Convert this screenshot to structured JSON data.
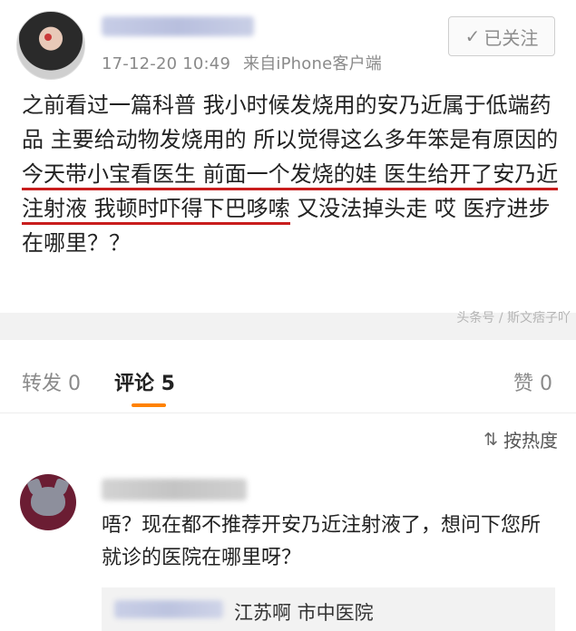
{
  "post": {
    "timestamp": "17-12-20 10:49",
    "source": "来自iPhone客户端",
    "follow_check": "✓",
    "follow_label": "已关注",
    "text_before": "之前看过一篇科普 我小时候发烧用的安乃近属于低端药品 主要给动物发烧用的 所以觉得这么多年笨是有原因的 ",
    "text_underlined": "今天带小宝看医生 前面一个发烧的娃 医生给开了安乃近注射液 我顿时吓得下巴哆嗦",
    "text_after": " 又没法掉头走 哎 医疗进步在哪里？？"
  },
  "watermark": "头条号 / 斯文痞子吖",
  "tabs": {
    "repost": "转发 0",
    "comments": "评论 5",
    "likes": "赞 0"
  },
  "sort": {
    "icon": "⇅",
    "label": "按热度"
  },
  "comment": {
    "text": "唔？现在都不推荐开安乃近注射液了，想问下您所就诊的医院在哪里呀？"
  },
  "reply": {
    "text": "江苏啊  市中医院"
  },
  "colors": {
    "accent": "#ff8200",
    "underline": "#c81d1d"
  }
}
